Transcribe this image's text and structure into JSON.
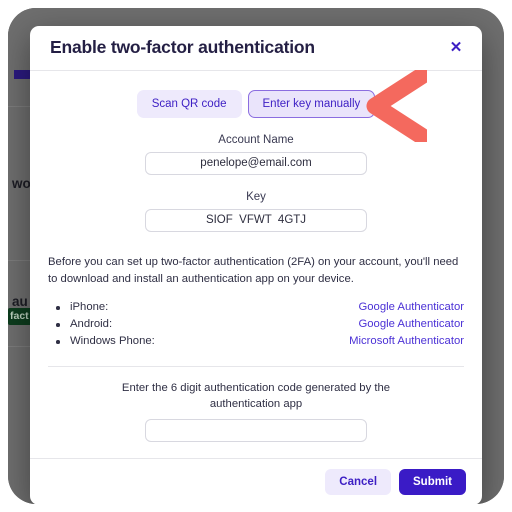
{
  "modal": {
    "title": "Enable two-factor authentication",
    "close_icon": "close-icon",
    "tabs": [
      {
        "label": "Scan QR code",
        "selected": false
      },
      {
        "label": "Enter key manually",
        "selected": true
      }
    ],
    "fields": [
      {
        "label": "Account Name",
        "value": "penelope@email.com",
        "placeholder": ""
      },
      {
        "label": "Key",
        "value": "SIOF  VFWT  4GTJ",
        "placeholder": ""
      }
    ],
    "intro_paragraph": "Before you can set up two-factor authentication (2FA) on your account, you'll need to download and install an authentication app on your device.",
    "app_list": [
      {
        "platform": "iPhone:",
        "link": "Google Authenticator"
      },
      {
        "platform": "Android:",
        "link": "Google Authenticator"
      },
      {
        "platform": "Windows Phone:",
        "link": "Microsoft Authenticator"
      }
    ],
    "code_prompt": "Enter the 6 digit authentication code generated by the authentication app",
    "code_value": "",
    "code_placeholder": "",
    "footer": {
      "cancel_label": "Cancel",
      "submit_label": "Submit"
    }
  },
  "annotation": {
    "arrow_icon": "left-chevron-arrow-icon",
    "color": "#f4695e"
  },
  "background": {
    "accent_color": "#2b1a80",
    "badge_text": "fact",
    "text_fragments": [
      "wo",
      "au"
    ]
  },
  "colors": {
    "brand_purple": "#3a1bc6",
    "link_purple": "#4b31d6",
    "tab_bg": "#eeeafc",
    "title_ink": "#241f44",
    "overlay": "#6f6f6f"
  }
}
